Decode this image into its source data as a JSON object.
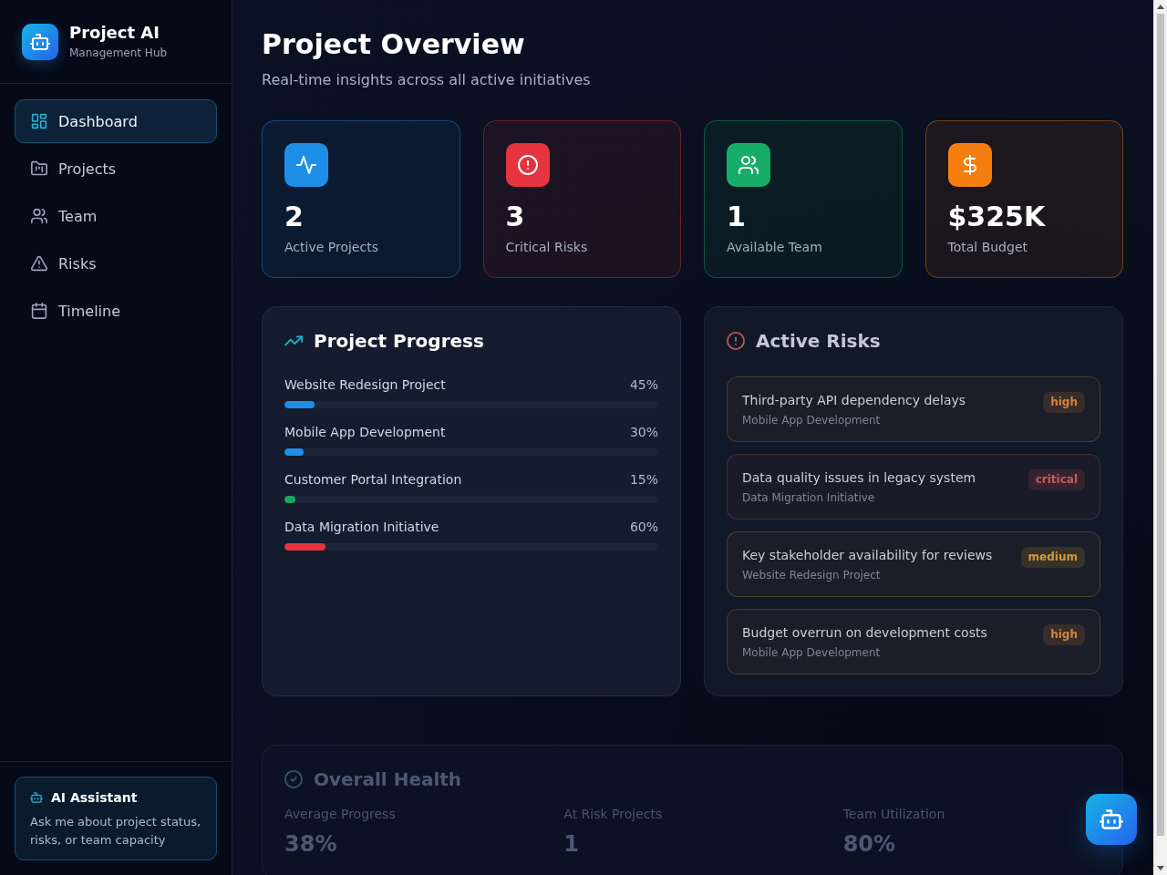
{
  "sidebar": {
    "brand": {
      "title": "Project AI",
      "subtitle": "Management Hub"
    },
    "nav_items": [
      {
        "label": "Dashboard",
        "selected": true
      },
      {
        "label": "Projects",
        "selected": false
      },
      {
        "label": "Team",
        "selected": false
      },
      {
        "label": "Risks",
        "selected": false
      },
      {
        "label": "Timeline",
        "selected": false
      }
    ],
    "assistant_card": {
      "title": "AI Assistant",
      "text": "Ask me about project status, risks, or team capacity"
    }
  },
  "header": {
    "title": "Project Overview",
    "subtitle": "Real-time insights across all active initiatives"
  },
  "stats": [
    {
      "value": "2",
      "label": "Active Projects",
      "color": "#1d8fe6"
    },
    {
      "value": "3",
      "label": "Critical Risks",
      "color": "#e5343f"
    },
    {
      "value": "1",
      "label": "Available Team",
      "color": "#17ad69"
    },
    {
      "value": "$325K",
      "label": "Total Budget",
      "color": "#f47f0e"
    }
  ],
  "progress_panel": {
    "title": "Project Progress",
    "projects": [
      {
        "name": "Website Redesign Project",
        "percent": "45%",
        "level": 0.08,
        "color": "#1e8ee8"
      },
      {
        "name": "Mobile App Development",
        "percent": "30%",
        "level": 0.05,
        "color": "#1e8ee8"
      },
      {
        "name": "Customer Portal Integration",
        "percent": "15%",
        "level": 0.03,
        "color": "#17a85e"
      },
      {
        "name": "Data Migration Initiative",
        "percent": "60%",
        "level": 0.11,
        "color": "#e5343f"
      }
    ]
  },
  "risks_panel": {
    "title": "Active Risks",
    "risks": [
      {
        "title": "Third-party API dependency delays",
        "project": "Mobile App Development",
        "severity": "high",
        "color": "#d4843a"
      },
      {
        "title": "Data quality issues in legacy system",
        "project": "Data Migration Initiative",
        "severity": "critical",
        "color": "#c65a55"
      },
      {
        "title": "Key stakeholder availability for reviews",
        "project": "Website Redesign Project",
        "severity": "medium",
        "color": "#cf9a36"
      },
      {
        "title": "Budget overrun on development costs",
        "project": "Mobile App Development",
        "severity": "high",
        "color": "#d4843a"
      }
    ]
  },
  "health_panel": {
    "title": "Overall Health",
    "metrics": [
      {
        "label": "Average Progress",
        "value": "38%"
      },
      {
        "label": "At Risk Projects",
        "value": "1"
      },
      {
        "label": "Team Utilization",
        "value": "80%"
      }
    ]
  }
}
